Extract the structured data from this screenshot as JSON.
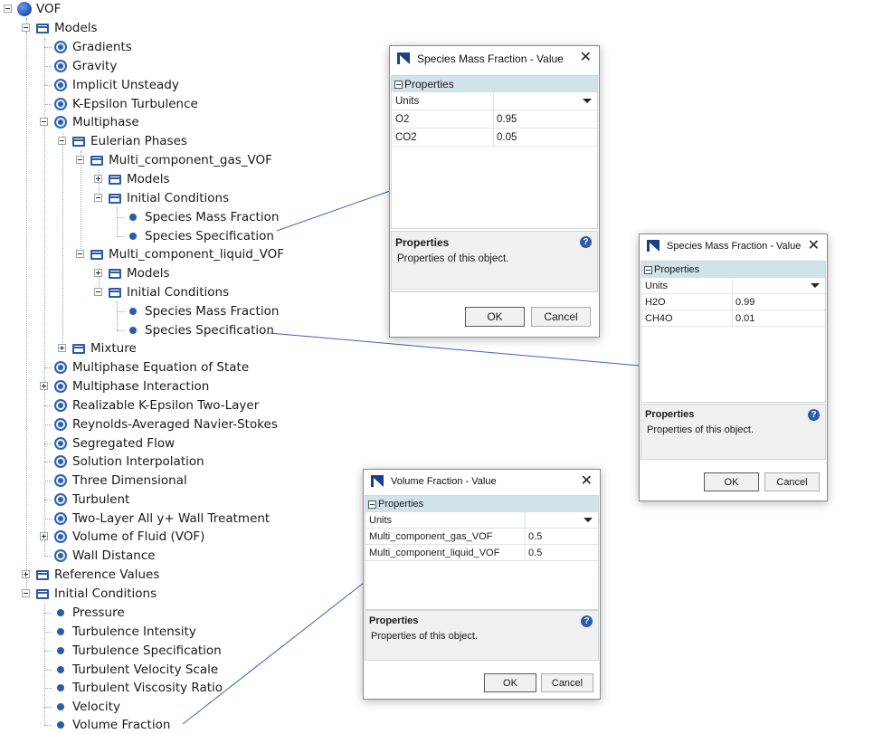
{
  "tree": {
    "root": "VOF",
    "models": "Models",
    "gradients": "Gradients",
    "gravity": "Gravity",
    "implicit_unsteady": "Implicit Unsteady",
    "k_epsilon": "K-Epsilon Turbulence",
    "multiphase": "Multiphase",
    "eulerian_phases": "Eulerian Phases",
    "gas_phase": "Multi_component_gas_VOF",
    "gas_models": "Models",
    "gas_initial_conditions": "Initial Conditions",
    "gas_species_mass_fraction": "Species Mass Fraction",
    "gas_species_specification": "Species Specification",
    "liquid_phase": "Multi_component_liquid_VOF",
    "liquid_models": "Models",
    "liquid_initial_conditions": "Initial Conditions",
    "liquid_species_mass_fraction": "Species Mass Fraction",
    "liquid_species_specification": "Species Specification",
    "mixture": "Mixture",
    "multiphase_eos": "Multiphase Equation of State",
    "multiphase_interaction": "Multiphase Interaction",
    "realizable_ke": "Realizable K-Epsilon Two-Layer",
    "rans": "Reynolds-Averaged Navier-Stokes",
    "segregated_flow": "Segregated Flow",
    "solution_interpolation": "Solution Interpolation",
    "three_dimensional": "Three Dimensional",
    "turbulent": "Turbulent",
    "two_layer_wall": "Two-Layer All y+ Wall Treatment",
    "vof_model": "Volume of Fluid (VOF)",
    "wall_distance": "Wall Distance",
    "reference_values": "Reference Values",
    "initial_conditions": "Initial Conditions",
    "pressure": "Pressure",
    "turbulence_intensity": "Turbulence Intensity",
    "turbulence_specification": "Turbulence Specification",
    "turbulent_velocity_scale": "Turbulent Velocity Scale",
    "turbulent_viscosity_ratio": "Turbulent Viscosity Ratio",
    "velocity": "Velocity",
    "volume_fraction": "Volume Fraction"
  },
  "dialog_gas": {
    "title": "Species Mass Fraction - Value",
    "close": "✕",
    "section": "Properties",
    "units_label": "Units",
    "rows": [
      {
        "name": "O2",
        "value": "0.95"
      },
      {
        "name": "CO2",
        "value": "0.05"
      }
    ],
    "desc_title": "Properties",
    "desc_text": "Properties of this object.",
    "help": "?",
    "ok": "OK",
    "cancel": "Cancel"
  },
  "dialog_liquid": {
    "title": "Species Mass Fraction - Value",
    "close": "✕",
    "section": "Properties",
    "units_label": "Units",
    "rows": [
      {
        "name": "H2O",
        "value": "0.99"
      },
      {
        "name": "CH4O",
        "value": "0.01"
      }
    ],
    "desc_title": "Properties",
    "desc_text": "Properties of this object.",
    "help": "?",
    "ok": "OK",
    "cancel": "Cancel"
  },
  "dialog_volume": {
    "title": "Volume Fraction - Value",
    "close": "✕",
    "section": "Properties",
    "units_label": "Units",
    "rows": [
      {
        "name": "Multi_component_gas_VOF",
        "value": "0.5"
      },
      {
        "name": "Multi_component_liquid_VOF",
        "value": "0.5"
      }
    ],
    "desc_title": "Properties",
    "desc_text": "Properties of this object.",
    "help": "?",
    "ok": "OK",
    "cancel": "Cancel"
  },
  "colors": {
    "tree_icon": "#2a5aa8",
    "grid_header": "#cfe3e8",
    "connector": "#3a63b8"
  }
}
